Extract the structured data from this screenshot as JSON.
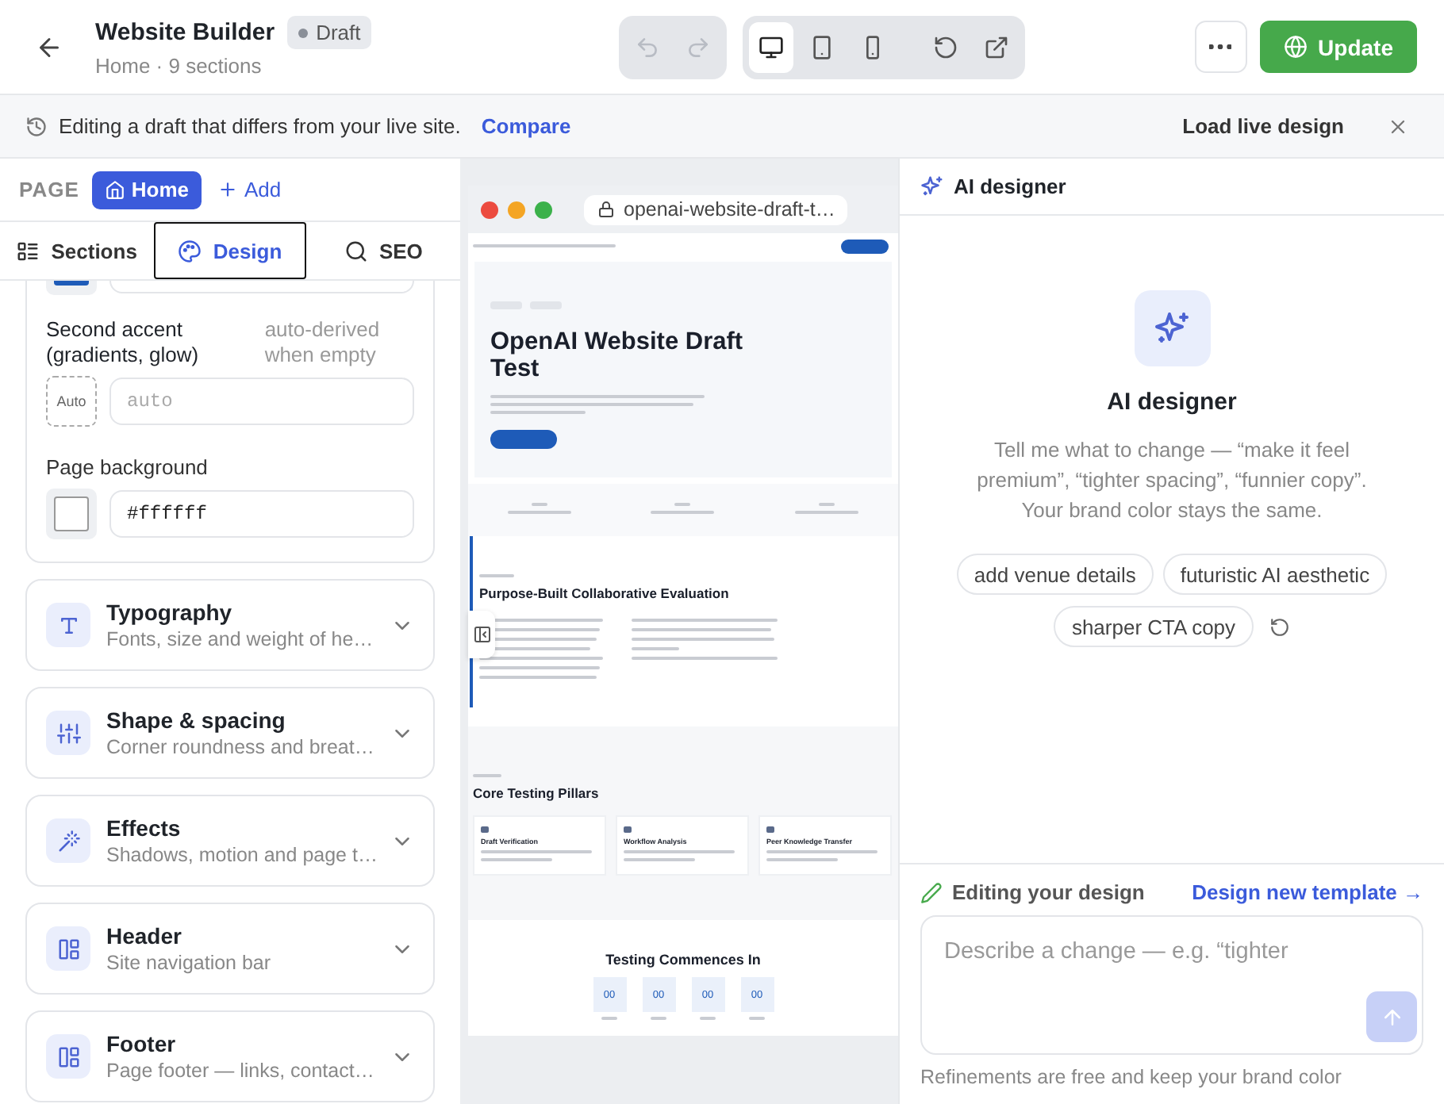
{
  "header": {
    "title": "Website Builder",
    "status": "Draft",
    "subtitle": "Home · 9 sections",
    "history": [
      {
        "kind": "undo",
        "disabled": true
      },
      {
        "kind": "redo",
        "disabled": true
      }
    ],
    "devices": [
      {
        "kind": "desktop",
        "selected": true
      },
      {
        "kind": "tablet",
        "selected": false
      },
      {
        "kind": "phone",
        "selected": false
      }
    ],
    "update_button": "Update"
  },
  "banner": {
    "message": "Editing a draft that differs from your live site.",
    "link": "Compare",
    "action": "Load live design"
  },
  "page_bar": {
    "label": "PAGE",
    "pages": [
      {
        "label": "Home",
        "selected": true
      }
    ],
    "add": "Add"
  },
  "tabs": [
    {
      "kind": "sections",
      "label": "Sections",
      "selected": false
    },
    {
      "kind": "design",
      "label": "Design",
      "selected": true
    },
    {
      "kind": "seo",
      "label": "SEO",
      "selected": false
    }
  ],
  "colors": {
    "brand": {
      "color": "#1e5bb8"
    },
    "second_accent": {
      "label": "Second accent (gradients, glow)",
      "note": "auto-derived when empty",
      "swatch_text": "Auto",
      "placeholder": "auto"
    },
    "page_background": {
      "label": "Page background",
      "value": "#ffffff",
      "color": "#ffffff"
    }
  },
  "design_sections": [
    {
      "kind": "typography",
      "title": "Typography",
      "subtitle": "Fonts, size and weight of he…",
      "expanded": false
    },
    {
      "kind": "shape",
      "title": "Shape & spacing",
      "subtitle": "Corner roundness and breat…",
      "expanded": false
    },
    {
      "kind": "effects",
      "title": "Effects",
      "subtitle": "Shadows, motion and page t…",
      "expanded": false
    },
    {
      "kind": "layout",
      "title": "Header",
      "subtitle": "Site navigation bar",
      "expanded": false
    },
    {
      "kind": "layout",
      "title": "Footer",
      "subtitle": "Page footer — links, contact…",
      "expanded": false
    }
  ],
  "preview": {
    "url": "openai-website-draft-t…",
    "hero": {
      "title": "OpenAI Website Draft Test"
    },
    "about": {
      "title": "Purpose-Built Collaborative Evaluation"
    },
    "pillars": {
      "title": "Core Testing Pillars",
      "cards": [
        {
          "title": "Draft Verification"
        },
        {
          "title": "Workflow Analysis"
        },
        {
          "title": "Peer Knowledge Transfer"
        }
      ]
    },
    "countdown": {
      "title": "Testing Commences In",
      "units": [
        "00",
        "00",
        "00",
        "00"
      ]
    }
  },
  "ai_panel": {
    "title": "AI designer",
    "heading": "AI designer",
    "description": "Tell me what to change — “make it feel premium”, “tighter spacing”, “funnier copy”. Your brand color stays the same.",
    "suggestions": [
      "add venue details",
      "futuristic AI aesthetic",
      "sharper CTA copy"
    ],
    "mode": "Editing your design",
    "template_link": "Design new template →",
    "input": {
      "placeholder": "Describe a change — e.g. “tighter"
    },
    "send_disabled": true,
    "footnote": "Refinements are free and keep your brand color"
  }
}
